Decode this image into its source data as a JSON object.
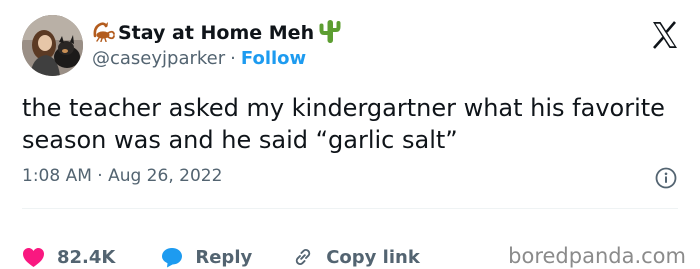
{
  "author": {
    "display_name": "Stay at Home Meh",
    "handle": "@caseyjparker",
    "separator": "·",
    "follow_label": "Follow"
  },
  "tweet": {
    "text": "the teacher asked my kindergartner what his favorite season was and he said “garlic salt”",
    "timestamp": "1:08 AM · Aug 26, 2022"
  },
  "actions": {
    "likes": "82.4K",
    "reply_label": "Reply",
    "copy_link_label": "Copy link"
  },
  "watermark": "boredpanda.com",
  "icons": {
    "name_prefix": "scorpion-icon",
    "name_suffix": "cactus-icon",
    "brand": "x-logo-icon",
    "info": "info-icon",
    "like": "heart-icon",
    "reply": "speech-bubble-icon",
    "copy": "link-icon"
  },
  "colors": {
    "text": "#0f1419",
    "secondary": "#536471",
    "follow": "#1d9bf0",
    "like": "#f91880",
    "reply": "#1d9bf0",
    "watermark": "#8b8b8b"
  }
}
